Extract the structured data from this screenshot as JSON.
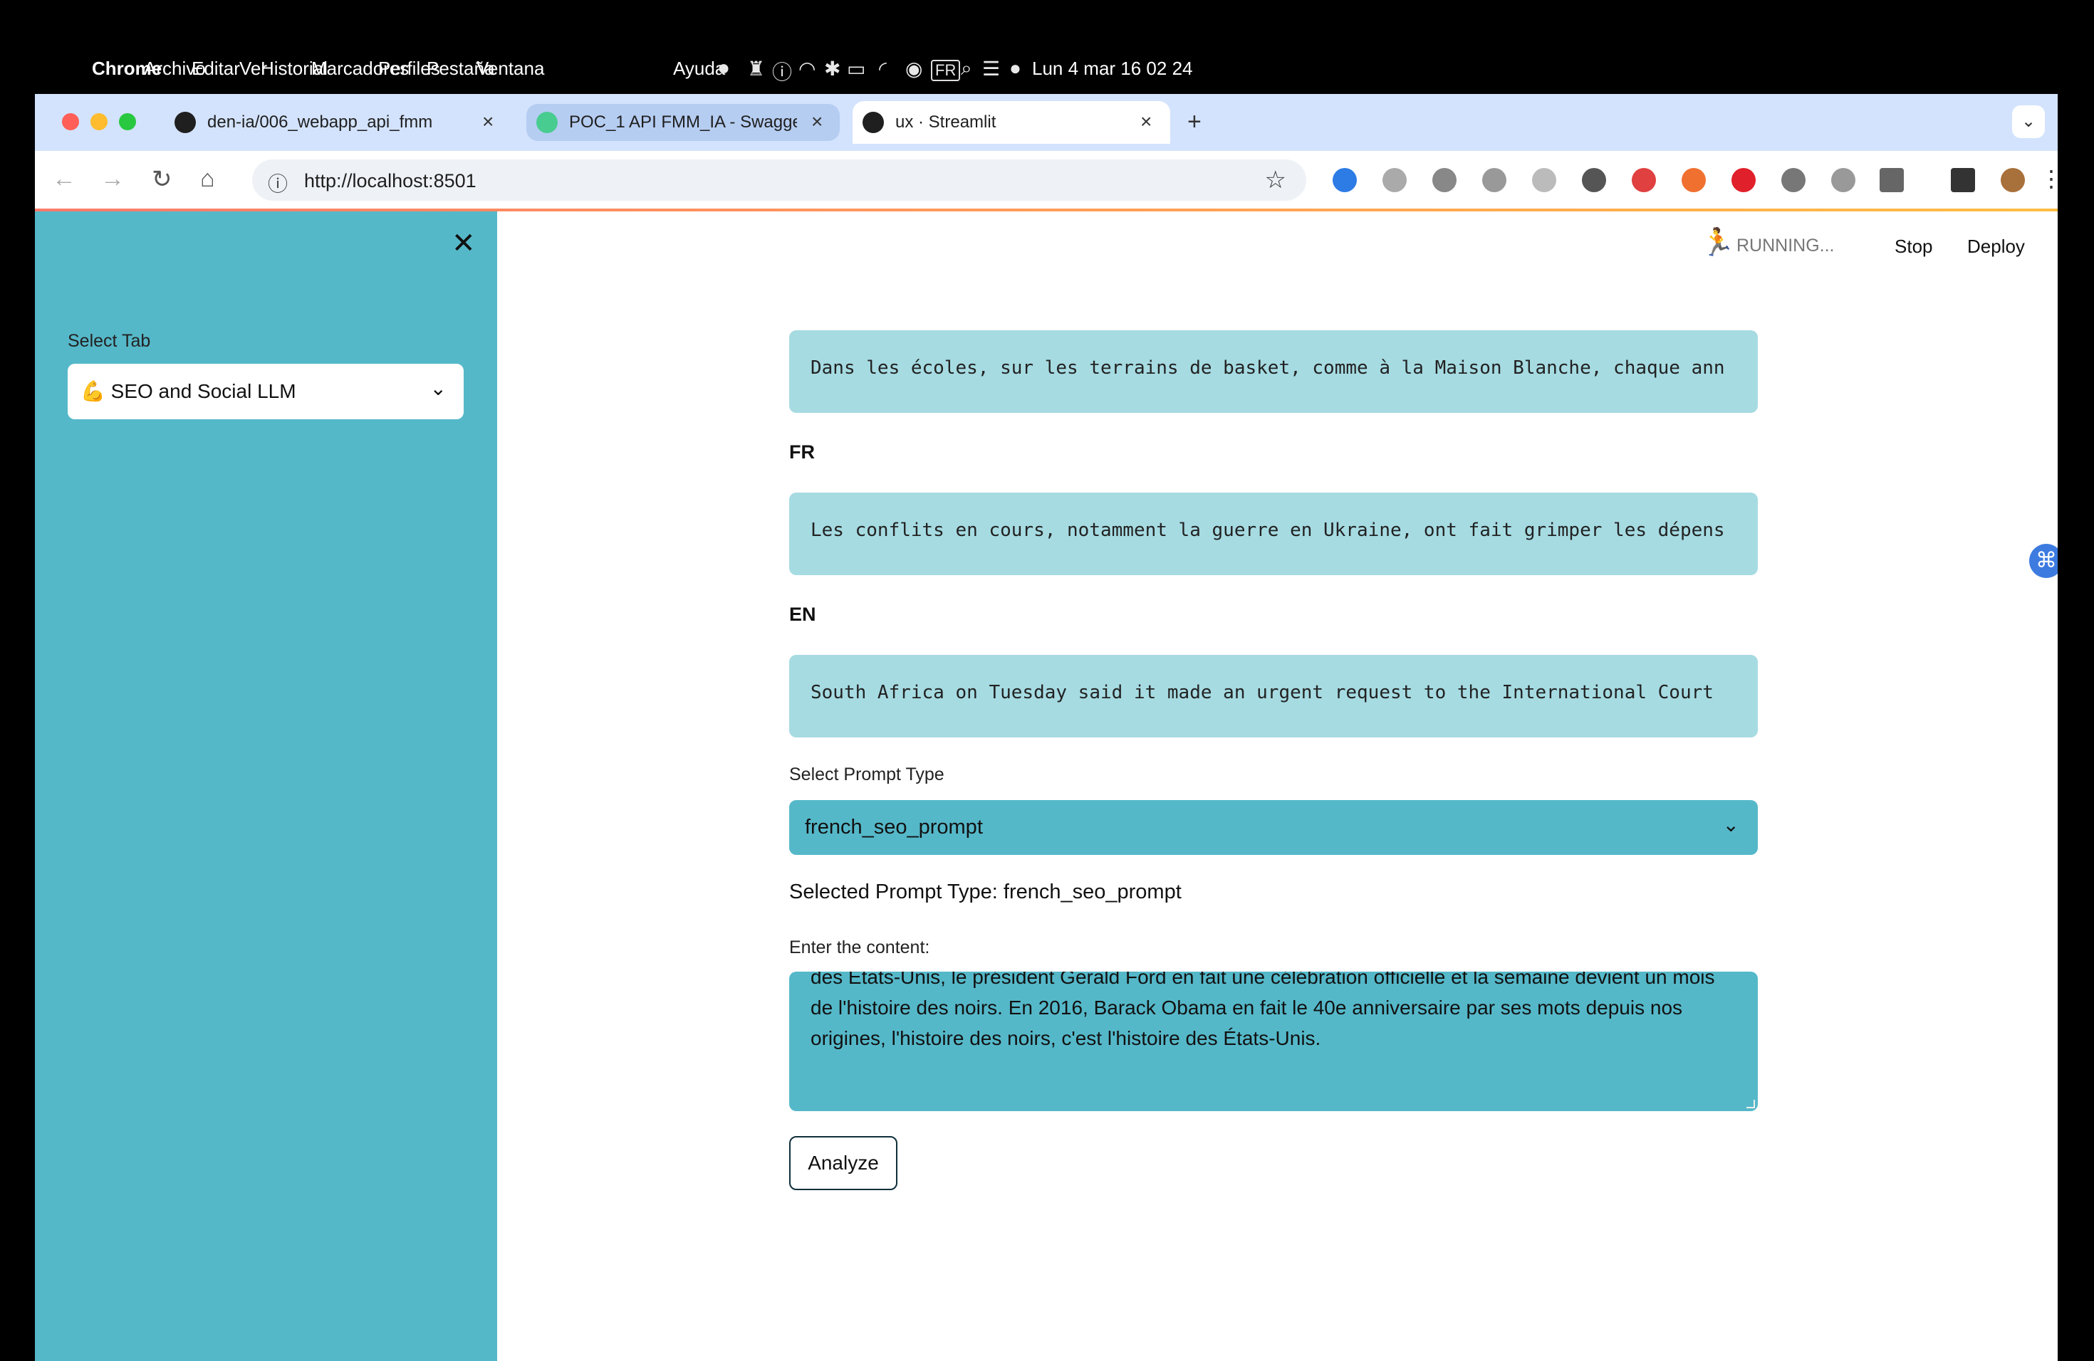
{
  "menubar": {
    "app_name": "Chrome",
    "menus": [
      "Archivo",
      "Editar",
      "Ver",
      "Historial",
      "Marcadores",
      "Perfiles",
      "Pestaña",
      "Ventana",
      "Ayuda"
    ],
    "input_source": "FR",
    "clock": "Lun 4 mar 16 02 24"
  },
  "tabs": [
    {
      "title": "den-ia/006_webapp_api_fmm",
      "favicon": "github-icon"
    },
    {
      "title": "POC_1 API FMM_IA - Swagger",
      "favicon": "swagger-icon"
    },
    {
      "title": "ux · Streamlit",
      "favicon": "streamlit-icon",
      "active": true
    }
  ],
  "address_bar": {
    "url": "http://localhost:8501"
  },
  "sidebar": {
    "select_label": "Select Tab",
    "select_value": "💪 SEO and Social LLM"
  },
  "topbar": {
    "status": "RUNNING...",
    "stop_label": "Stop",
    "deploy_label": "Deploy"
  },
  "main": {
    "code_block_1": "Dans les écoles, sur les terrains de basket, comme à la Maison Blanche, chaque ann",
    "heading_fr": "FR",
    "code_block_2": "Les conflits en cours, notamment la guerre en Ukraine, ont fait grimper les dépens",
    "heading_en": "EN",
    "code_block_3": "South Africa on Tuesday said it made an urgent request to the International Court",
    "prompt_type_label": "Select Prompt Type",
    "prompt_type_value": "french_seo_prompt",
    "selected_prompt_text": "Selected Prompt Type: french_seo_prompt",
    "content_label": "Enter the content:",
    "content_value": "des États-Unis, le président Gerald Ford en fait une célébration officielle et la semaine devient un mois de l'histoire des noirs. En 2016, Barack Obama en fait le 40e anniversaire par ses mots depuis nos origines, l'histoire des noirs, c'est l'histoire des États-Unis.",
    "analyze_label": "Analyze"
  },
  "colors": {
    "sidebar_bg": "#55b8c9",
    "code_bg": "#a6dbe2",
    "tabstrip_bg": "#d3e3fd"
  }
}
